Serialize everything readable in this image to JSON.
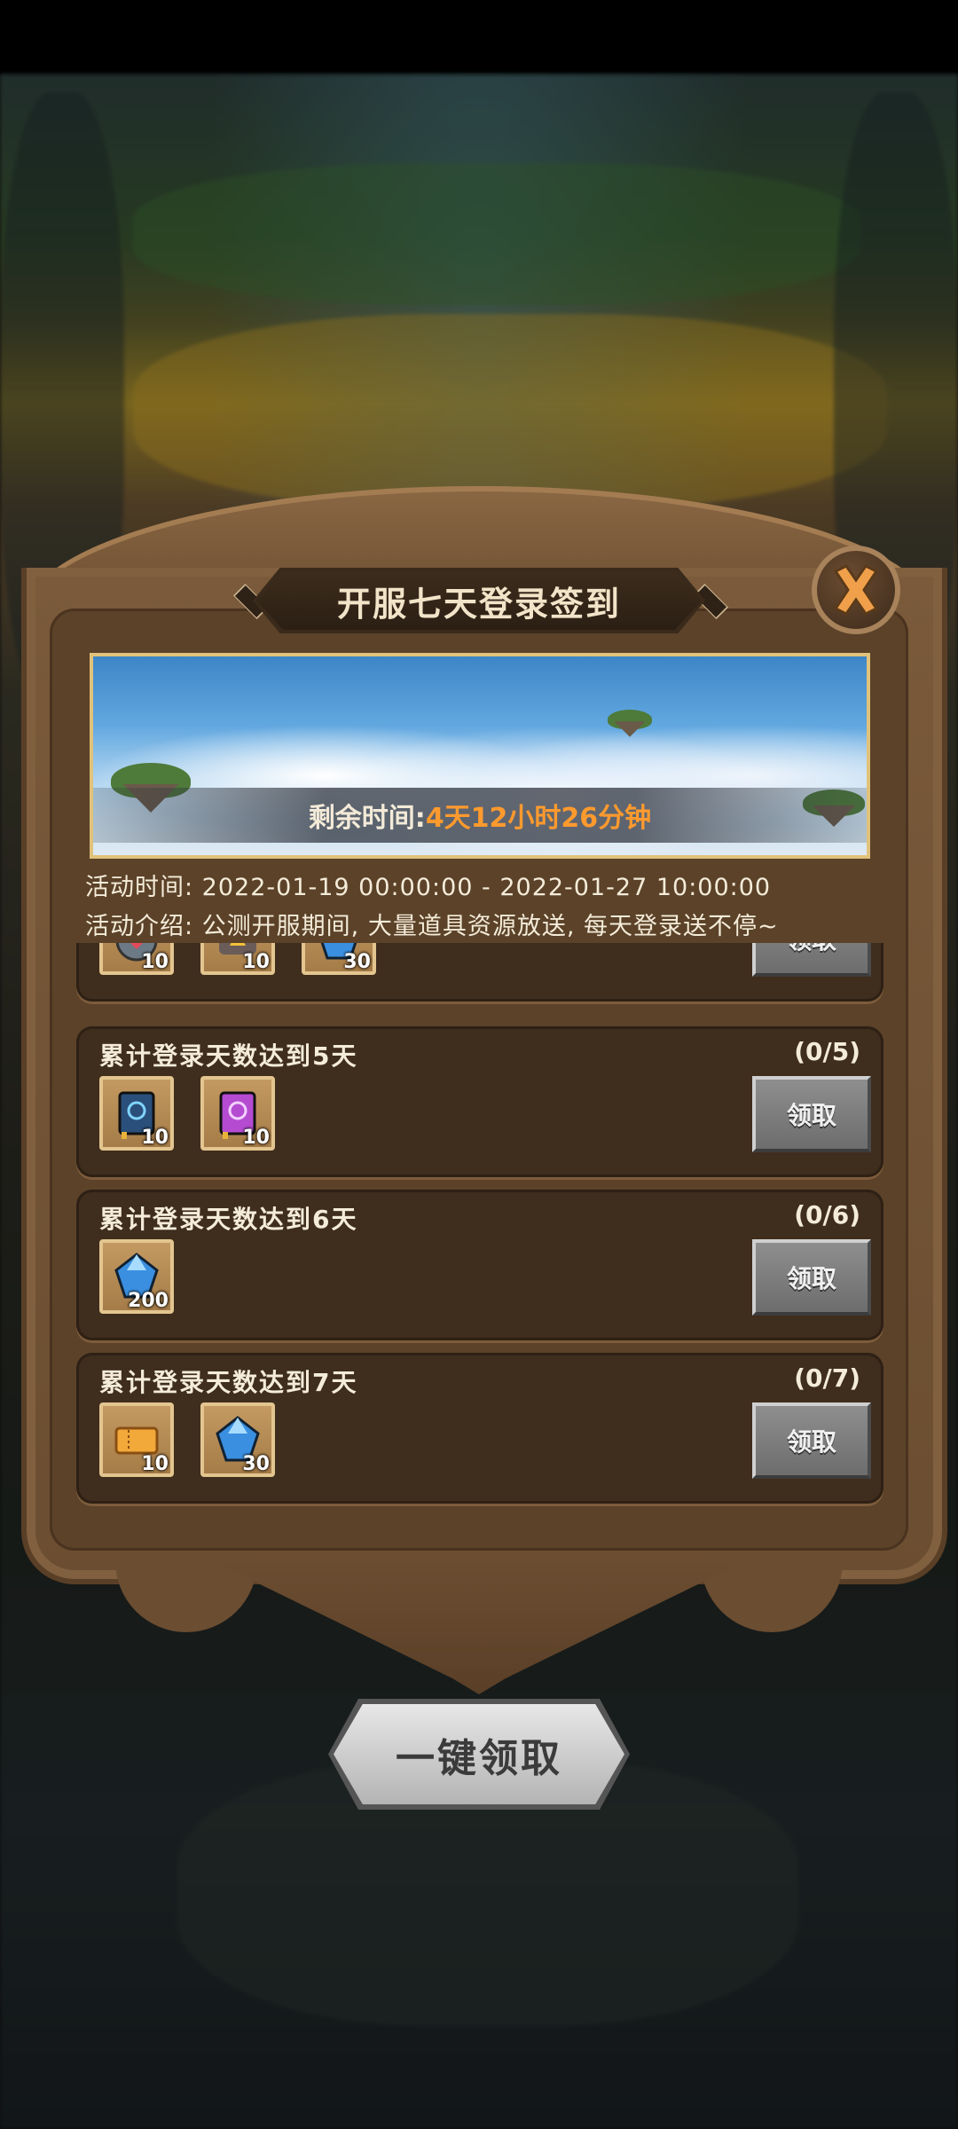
{
  "panel": {
    "title": "开服七天登录签到",
    "timer_label": "剩余时间:",
    "timer_value": "4天12小时26分钟",
    "activity_time": "活动时间: 2022-01-19 00:00:00 - 2022-01-27 10:00:00",
    "activity_intro": "活动介绍: 公测开服期间, 大量道具资源放送, 每天登录送不停~"
  },
  "rewards": [
    {
      "title": "",
      "progress": "",
      "claim_label": "领取",
      "items": [
        {
          "icon": "heart-potion-icon",
          "count": "10"
        },
        {
          "icon": "fire-scroll-icon",
          "count": "10"
        },
        {
          "icon": "blue-gem-icon",
          "count": "30"
        }
      ]
    },
    {
      "title": "累计登录天数达到5天",
      "progress": "(0/5)",
      "claim_label": "领取",
      "items": [
        {
          "icon": "blue-book-icon",
          "count": "10"
        },
        {
          "icon": "purple-book-icon",
          "count": "10"
        }
      ]
    },
    {
      "title": "累计登录天数达到6天",
      "progress": "(0/6)",
      "claim_label": "领取",
      "items": [
        {
          "icon": "blue-gem-icon",
          "count": "200"
        }
      ]
    },
    {
      "title": "累计登录天数达到7天",
      "progress": "(0/7)",
      "claim_label": "领取",
      "items": [
        {
          "icon": "gold-ticket-icon",
          "count": "10"
        },
        {
          "icon": "blue-gem-icon",
          "count": "30"
        }
      ]
    }
  ],
  "one_key_label": "一键领取",
  "colors": {
    "panel_wood": "#7a5a3a",
    "card_bg": "#3f2d1d",
    "timer_highlight": "#ff9a2e",
    "text_light": "#f4ecd9"
  }
}
